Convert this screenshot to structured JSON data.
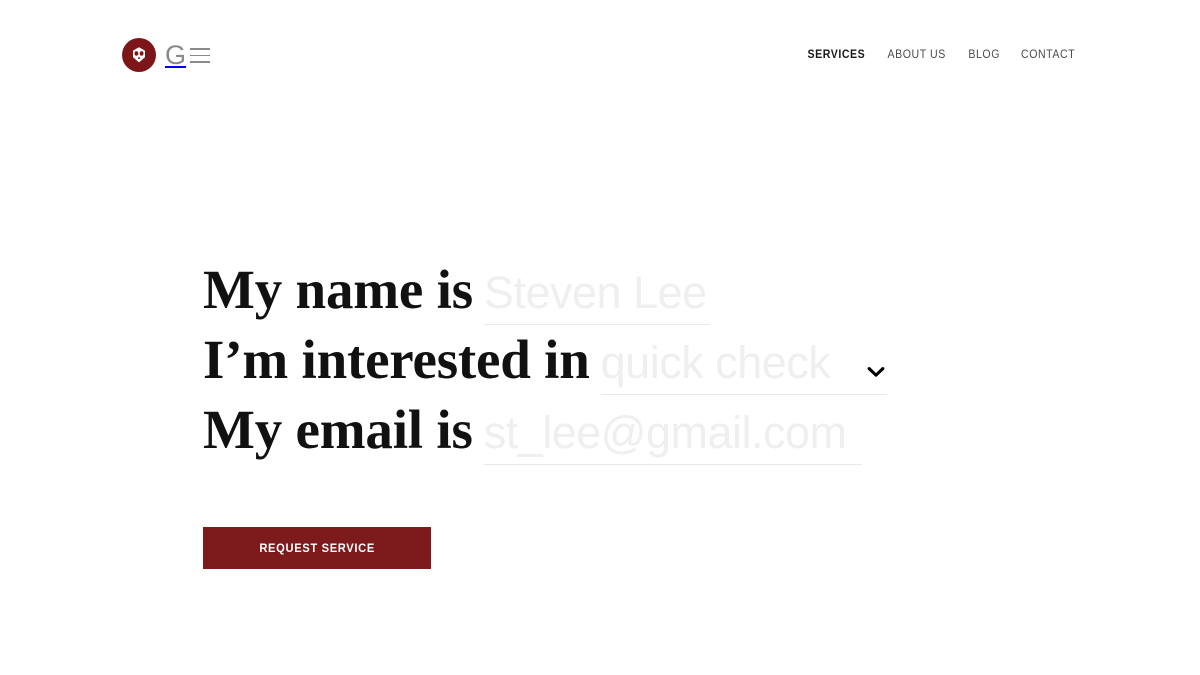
{
  "brand": {
    "mark_icon": "skull-badge-icon",
    "letter": "G",
    "mark_color": "#7d1618",
    "word_color": "#8a8a8a"
  },
  "nav": {
    "items": [
      {
        "label": "SERVICES",
        "active": true
      },
      {
        "label": "ABOUT US",
        "active": false
      },
      {
        "label": "BLOG",
        "active": false
      },
      {
        "label": "CONTACT",
        "active": false
      }
    ]
  },
  "form": {
    "lines": [
      {
        "lead": "My name is",
        "field_name": "name-input",
        "placeholder": "Steven Lee",
        "value": "",
        "type": "text"
      },
      {
        "lead": "I’m interested in",
        "field_name": "service-select",
        "placeholder": "quick check",
        "value": "quick check",
        "type": "select",
        "icon": "chevron-down-icon"
      },
      {
        "lead": "My email is",
        "field_name": "email-input",
        "placeholder": "st_lee@gmail.com",
        "value": "",
        "type": "email"
      }
    ],
    "submit_label": "REQUEST SERVICE",
    "submit_color": "#7d1a1c",
    "placeholder_color": "#efefef",
    "underline_color": "#e9e9e9"
  }
}
